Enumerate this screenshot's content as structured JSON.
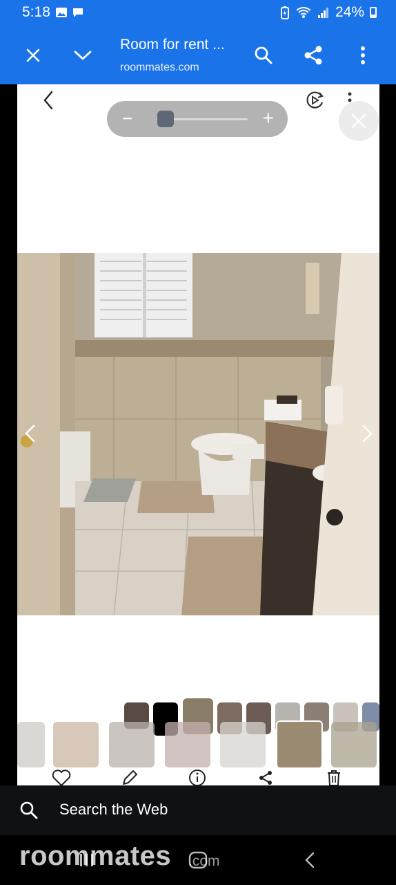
{
  "status_bar": {
    "time": "5:18",
    "battery": "24%",
    "left_icons": [
      "image-icon",
      "message-icon"
    ],
    "right_icons": [
      "battery-saver-icon",
      "wifi-icon",
      "signal-icon",
      "battery-icon"
    ]
  },
  "tab": {
    "title": "Room for rent ...",
    "url": "roommates.com",
    "icons": [
      "close-icon",
      "chevron-down-icon",
      "search-icon",
      "share-icon",
      "more-vert-icon"
    ]
  },
  "viewer": {
    "zoom_level": 0.1,
    "icons": [
      "back-chevron-icon",
      "slideshow-icon",
      "more-vert-icon",
      "close-icon",
      "chevron-left-icon",
      "chevron-right-icon"
    ],
    "actions": [
      "heart-icon",
      "pencil-icon",
      "info-icon",
      "share-icon",
      "trash-icon"
    ]
  },
  "search_web": {
    "label": "Search the Web"
  },
  "watermark": {
    "name": "roommates",
    "tld": ".com"
  },
  "colors": {
    "brand": "#1a73e8",
    "search_bar": "#0f1115"
  }
}
